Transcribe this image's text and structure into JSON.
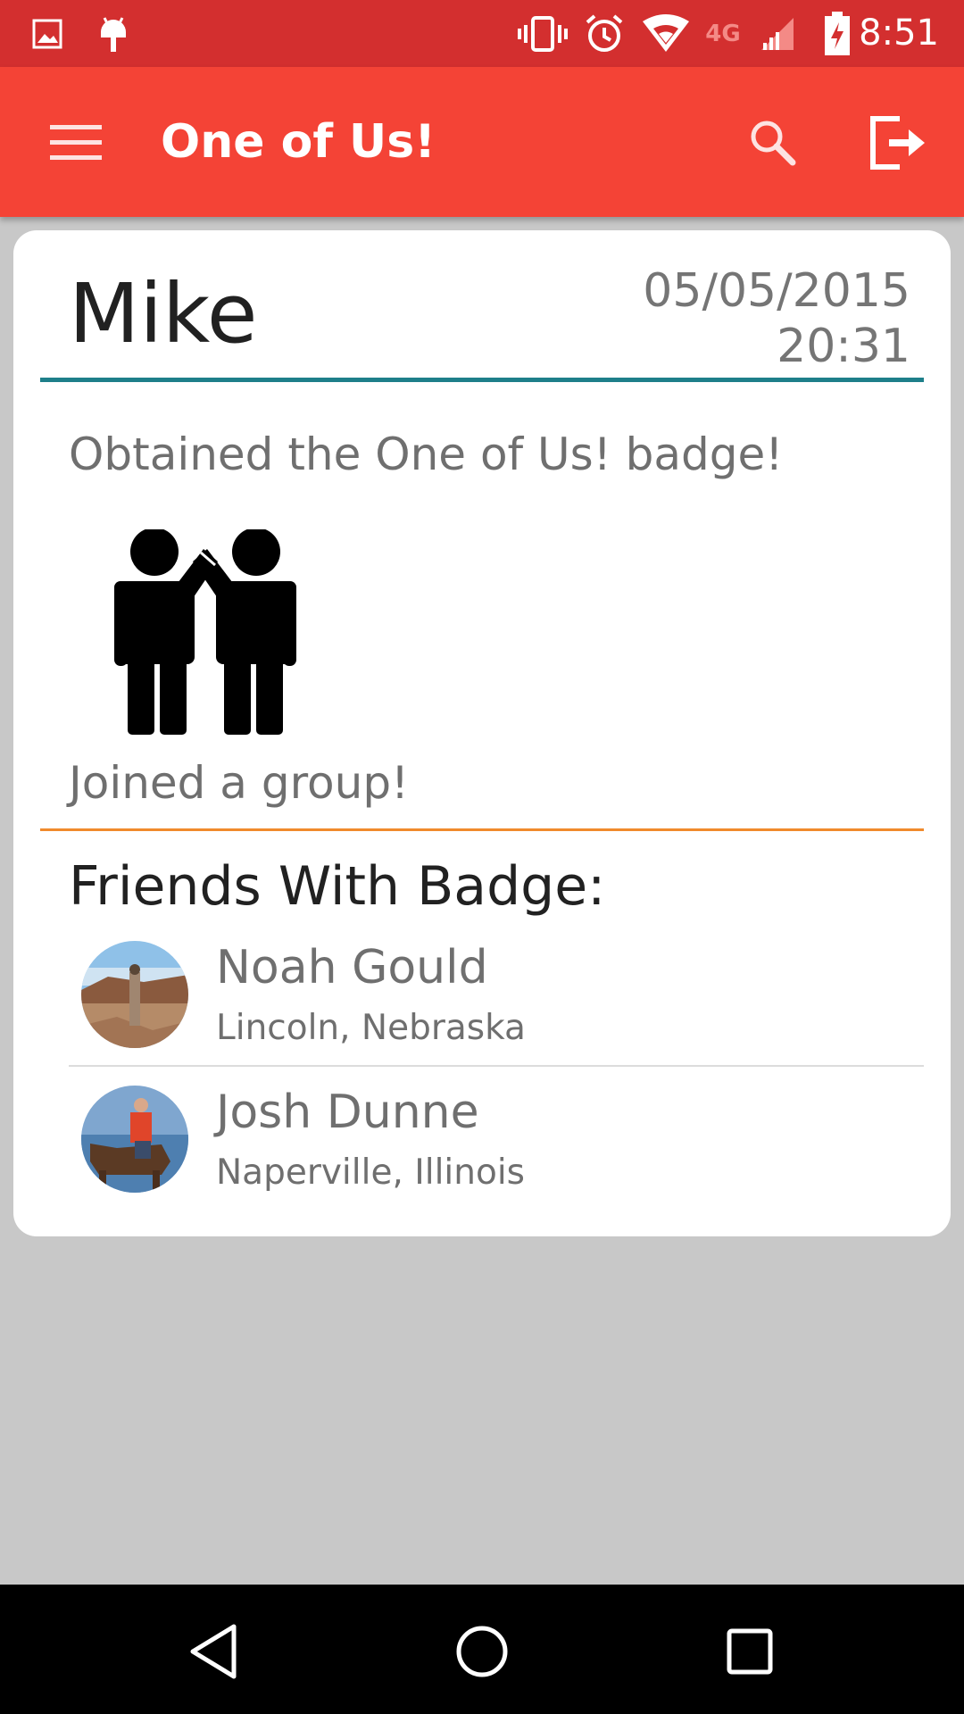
{
  "status_bar": {
    "time": "8:51",
    "network_label": "4G",
    "icons": [
      "gallery-icon",
      "android-icon",
      "vibrate-icon",
      "alarm-icon",
      "wifi-icon",
      "network-icon",
      "cell-signal-icon",
      "battery-charging-icon"
    ]
  },
  "app_bar": {
    "title": "One of Us!",
    "menu_icon": "hamburger-menu-icon",
    "search_icon": "search-icon",
    "logout_icon": "logout-icon"
  },
  "post": {
    "user_name": "Mike",
    "date": "05/05/2015",
    "time": "20:31",
    "activity_text": "Obtained the One of Us! badge!",
    "badge_icon": "group-high-five-icon",
    "badge_caption": "Joined a group!"
  },
  "friends": {
    "title": "Friends With Badge:",
    "items": [
      {
        "name": "Noah Gould",
        "location": "Lincoln, Nebraska",
        "avatar": "avatar-photo-desert"
      },
      {
        "name": "Josh Dunne",
        "location": "Naperville, Illinois",
        "avatar": "avatar-photo-horse"
      }
    ]
  },
  "nav_bar": {
    "back_icon": "back-icon",
    "home_icon": "home-icon",
    "recents_icon": "recents-icon"
  },
  "colors": {
    "status_bar": "#d32f2f",
    "app_bar": "#f44336",
    "header_divider": "#1e7f8a",
    "badge_divider": "#f08a2c",
    "background": "#c8c8c8"
  }
}
